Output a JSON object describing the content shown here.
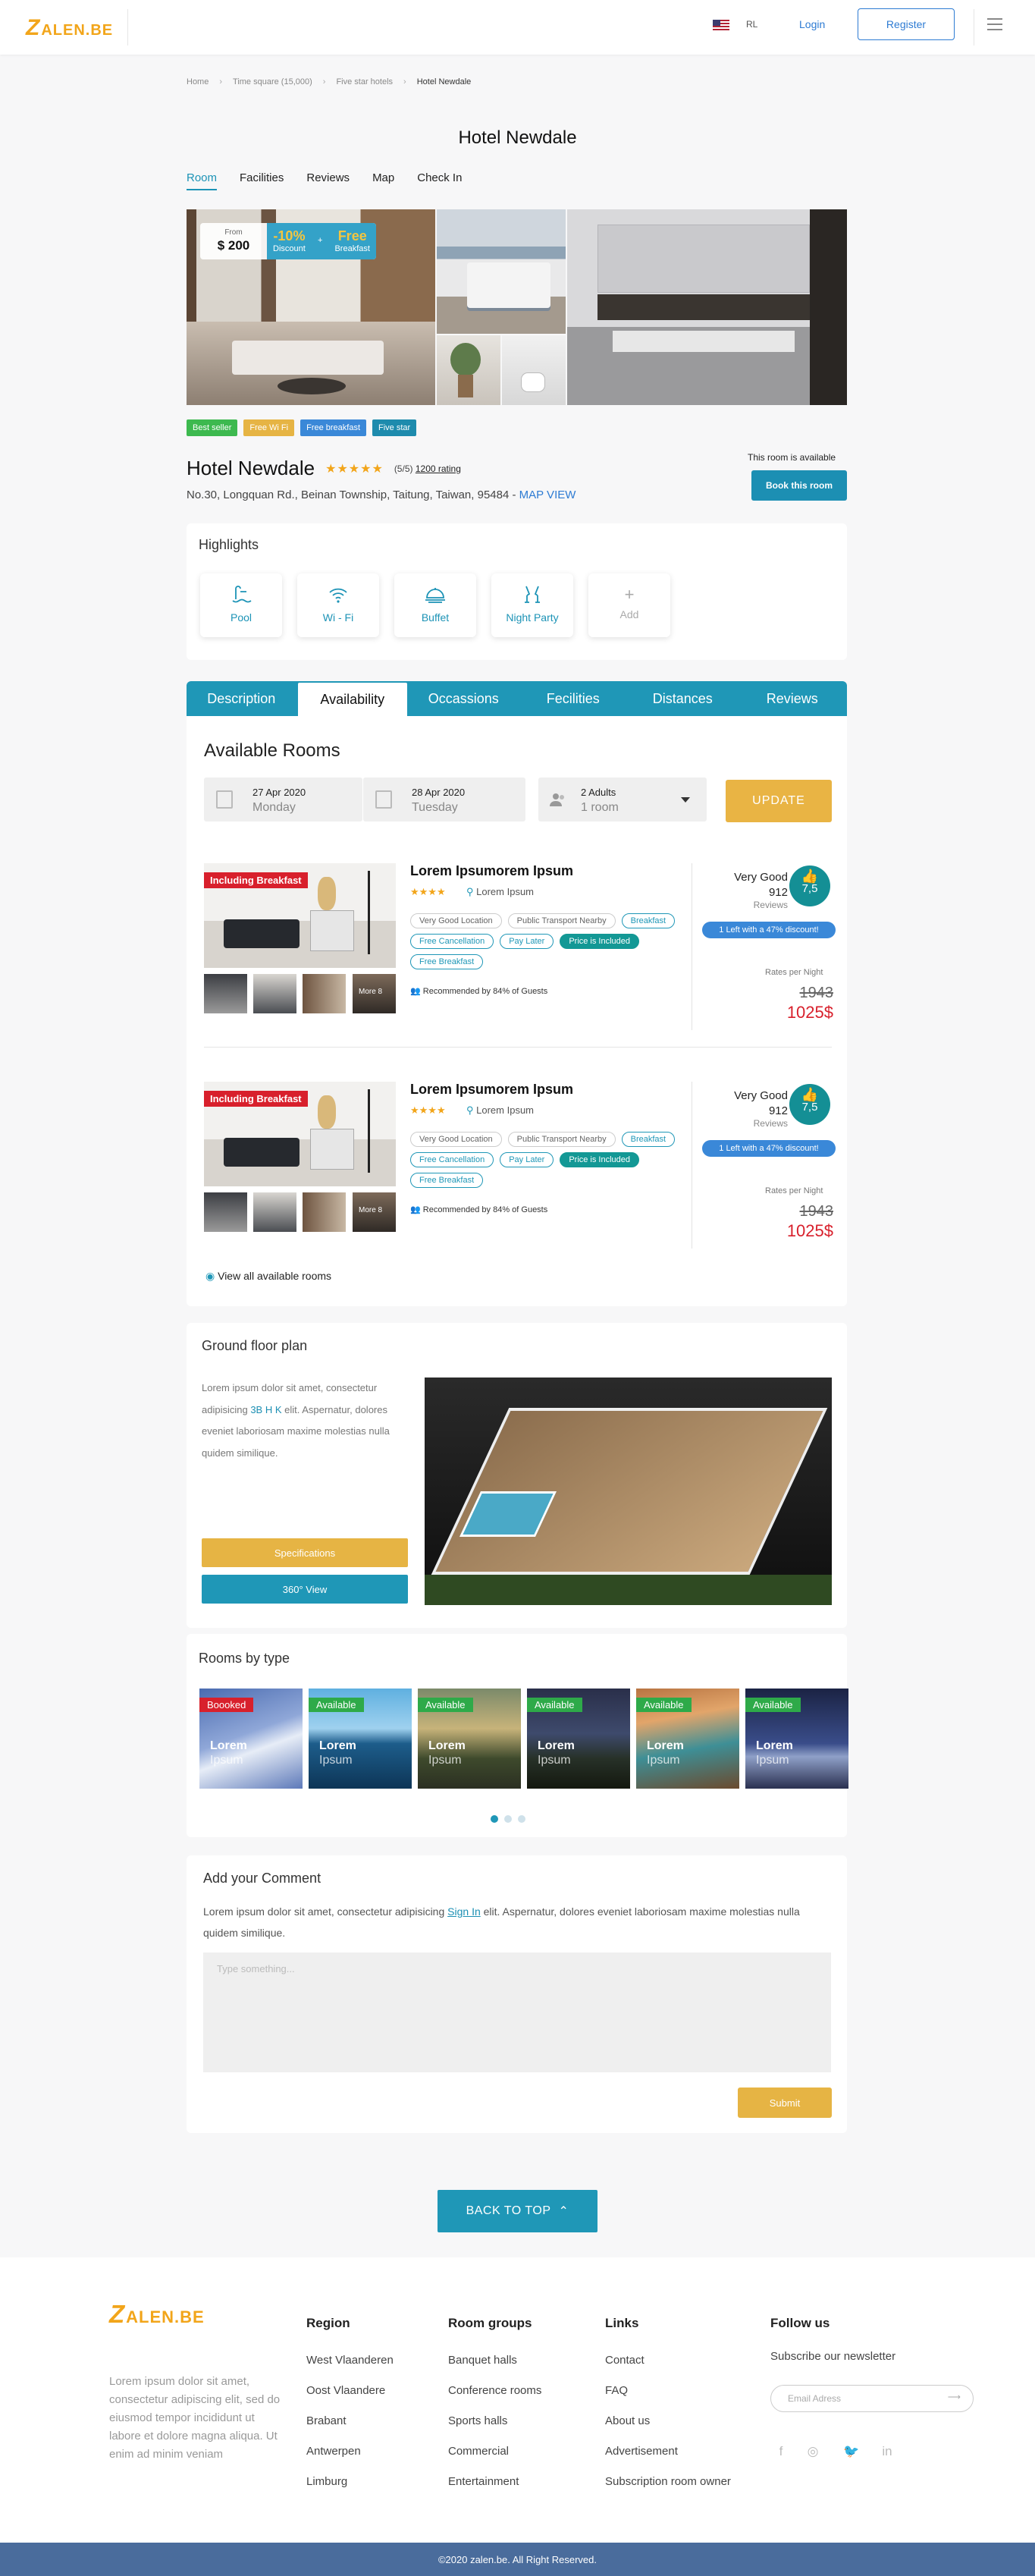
{
  "header": {
    "logo_letter": "Z",
    "logo_text": "ALEN.BE",
    "lang": "RL",
    "login": "Login",
    "register": "Register"
  },
  "breadcrumb": [
    "Home",
    "Time square (15,000)",
    "Five star hotels",
    "Hotel Newdale"
  ],
  "page_title": "Hotel Newdale",
  "top_tabs": [
    "Room",
    "Facilities",
    "Reviews",
    "Map",
    "Check In"
  ],
  "promo": {
    "from_label": "From",
    "price": "$ 200",
    "discount_value": "-10%",
    "discount_label": "Discount",
    "plus": "+",
    "free_value": "Free",
    "free_label": "Breakfast"
  },
  "badges": [
    {
      "label": "Best seller",
      "color": "#3db94f"
    },
    {
      "label": "Free Wi Fi",
      "color": "#e6b444"
    },
    {
      "label": "Free breakfast",
      "color": "#3a88d8"
    },
    {
      "label": "Five star",
      "color": "#1e8bad"
    }
  ],
  "hotel": {
    "name": "Hotel Newdale",
    "stars": "★★★★★",
    "score": "(5/5)",
    "rating": "1200 rating",
    "address": "No.30, Longquan Rd., Beinan Township, Taitung, Taiwan, 95484 - ",
    "map_link": "MAP VIEW",
    "availability": "This room is available",
    "book": "Book this room"
  },
  "highlights": {
    "title": "Highlights",
    "items": [
      {
        "label": "Pool",
        "icon": "pool-icon"
      },
      {
        "label": "Wi - Fi",
        "icon": "wifi-icon"
      },
      {
        "label": "Buffet",
        "icon": "buffet-icon"
      },
      {
        "label": "Night Party",
        "icon": "party-icon"
      },
      {
        "label": "Add",
        "icon": "plus-icon"
      }
    ]
  },
  "tabs": [
    "Description",
    "Availability",
    "Occassions",
    "Fecilities",
    "Distances",
    "Reviews"
  ],
  "availability": {
    "title": "Available Rooms",
    "checkin_date": "27 Apr 2020",
    "checkin_day": "Monday",
    "checkout_date": "28 Apr 2020",
    "checkout_day": "Tuesday",
    "guests": "2 Adults",
    "rooms": "1 room",
    "update": "UPDATE",
    "view_all": "View all available rooms"
  },
  "rooms": [
    {
      "ribbon": "Including Breakfast",
      "name": "Lorem Ipsumorem Ipsum",
      "stars": "★★★★",
      "location": "Lorem Ipsum",
      "tags": [
        "Very Good Location",
        "Public Transport Nearby",
        "Breakfast",
        "Free Cancellation",
        "Pay Later",
        "Price is Included",
        "Free Breakfast"
      ],
      "recommended": "Recommended by 84% of Guests",
      "more": "More 8",
      "rating_word": "Very Good",
      "reviews": "912",
      "reviews_label": "Reviews",
      "score": "7,5",
      "discount": "1 Left with a 47% discount!",
      "rates_label": "Rates per Night",
      "old_price": "1943",
      "new_price": "1025$"
    },
    {
      "ribbon": "Including Breakfast",
      "name": "Lorem Ipsumorem Ipsum",
      "stars": "★★★★",
      "location": "Lorem Ipsum",
      "tags": [
        "Very Good Location",
        "Public Transport Nearby",
        "Breakfast",
        "Free Cancellation",
        "Pay Later",
        "Price is Included",
        "Free Breakfast"
      ],
      "recommended": "Recommended by 84% of Guests",
      "more": "More 8",
      "rating_word": "Very Good",
      "reviews": "912",
      "reviews_label": "Reviews",
      "score": "7,5",
      "discount": "1 Left with a 47% discount!",
      "rates_label": "Rates per Night",
      "old_price": "1943",
      "new_price": "1025$"
    }
  ],
  "floorplan": {
    "title": "Ground floor plan",
    "text1": "Lorem ipsum dolor sit amet, consectetur adipisicing ",
    "link": "3B H K",
    "text2": " elit. Aspernatur, dolores eveniet laboriosam maxime molestias nulla quidem similique.",
    "spec": "Specifications",
    "view360": "360° View"
  },
  "rooms_by_type": {
    "title": "Rooms by type",
    "items": [
      {
        "status": "Boooked",
        "status_color": "#d8202c",
        "line1": "Lorem",
        "line2": "Ipsum",
        "bg": "linear-gradient(160deg,#4a6bb0,#8fa7d8 45%,#e7edf7 60%,#5d79b9)"
      },
      {
        "status": "Available",
        "status_color": "#2eaa49",
        "line1": "Lorem",
        "line2": "Ipsum",
        "bg": "linear-gradient(180deg,#5fb0e0,#9fd1ef 40%,#1d5d8b 55%,#0d3556)"
      },
      {
        "status": "Available",
        "status_color": "#2eaa49",
        "line1": "Lorem",
        "line2": "Ipsum",
        "bg": "linear-gradient(180deg,#7b8a6a,#c7b37a 40%,#3e4a2c 70%,#2b2f22)"
      },
      {
        "status": "Available",
        "status_color": "#2eaa49",
        "line1": "Lorem",
        "line2": "Ipsum",
        "bg": "linear-gradient(180deg,#2a2f4a,#3e4a6c 45%,#273128 70%,#14180f)"
      },
      {
        "status": "Available",
        "status_color": "#2eaa49",
        "line1": "Lorem",
        "line2": "Ipsum",
        "bg": "linear-gradient(170deg,#b87442,#e2a56a 30%,#3e8f96 60%,#6b4a2e)"
      },
      {
        "status": "Available",
        "status_color": "#2eaa49",
        "line1": "Lorem",
        "line2": "Ipsum",
        "bg": "linear-gradient(180deg,#1b2344,#3a4d8a 55%,#8fa0c8 68%,#2a3050)"
      }
    ]
  },
  "comment": {
    "title": "Add your Comment",
    "text1": "Lorem ipsum dolor sit amet, consectetur adipisicing ",
    "link": "Sign In",
    "text2": " elit. Aspernatur, dolores eveniet laboriosam maxime molestias nulla quidem similique.",
    "placeholder": "Type something...",
    "submit": "Submit"
  },
  "back_to_top": "BACK TO TOP",
  "footer": {
    "about": "Lorem ipsum dolor sit amet, consectetur adipiscing elit, sed do eiusmod tempor incididunt ut labore et dolore magna aliqua. Ut enim ad minim veniam",
    "region": {
      "title": "Region",
      "items": [
        "West Vlaanderen",
        "Oost Vlaandere",
        "Brabant",
        "Antwerpen",
        "Limburg"
      ]
    },
    "groups": {
      "title": "Room groups",
      "items": [
        "Banquet halls",
        "Conference rooms",
        "Sports halls",
        "Commercial",
        "Entertainment"
      ]
    },
    "links": {
      "title": "Links",
      "items": [
        "Contact",
        "FAQ",
        "About us",
        "Advertisement",
        "Subscription room owner"
      ]
    },
    "follow": {
      "title": "Follow us",
      "newsletter": "Subscribe our newsletter",
      "email_placeholder": "Email Adress",
      "socials": [
        "facebook-icon",
        "instagram-icon",
        "twitter-icon",
        "linkedin-icon"
      ]
    },
    "copyright": "©2020 zalen.be. All Right Reserved."
  }
}
